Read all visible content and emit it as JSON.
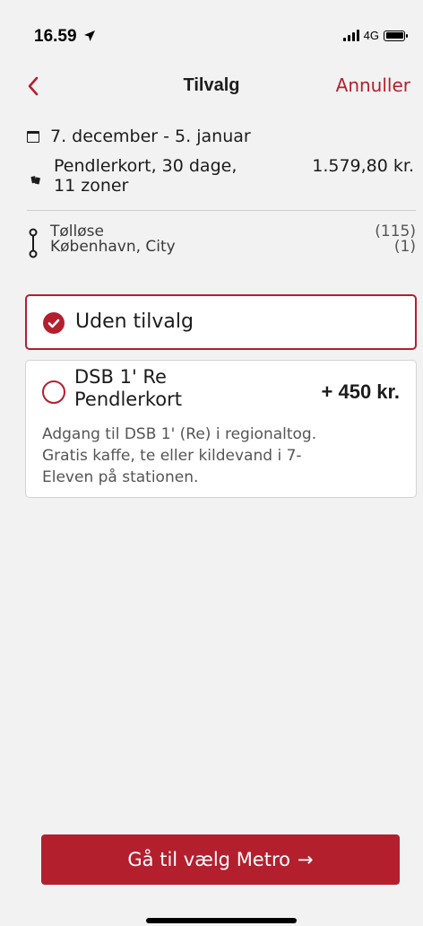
{
  "status_bar": {
    "time": "16.59",
    "network": "4G"
  },
  "nav": {
    "title": "Tilvalg",
    "cancel_label": "Annuller"
  },
  "summary": {
    "period": "7. december - 5. januar",
    "ticket_line1": "Pendlerkort, 30 dage,",
    "ticket_line2": "11 zoner",
    "ticket_price": "1.579,80 kr."
  },
  "route": {
    "from": "Tølløse",
    "to": "København, City",
    "from_zone": "(115)",
    "to_zone": "(1)"
  },
  "options": {
    "selected": {
      "label": "Uden tilvalg"
    },
    "other": {
      "name_line1": "DSB 1' Re",
      "name_line2": "Pendlerkort",
      "price": "+ 450 kr.",
      "desc_line1": "Adgang til DSB 1' (Re) i regionaltog.",
      "desc_line2": "Gratis kaffe, te eller kildevand i 7-",
      "desc_line3": "Eleven på stationen."
    }
  },
  "cta": {
    "label": "Gå til vælg Metro",
    "arrow": "→"
  },
  "colors": {
    "accent": "#b41f2e",
    "background": "#f2f2f2",
    "text": "#1c1c1c"
  },
  "icons": [
    "location-arrow-icon",
    "signal-icon",
    "battery-icon",
    "back-chevron-icon",
    "calendar-icon",
    "tickets-icon",
    "route-icon",
    "check-icon",
    "radio-icon",
    "arrow-right-icon"
  ]
}
